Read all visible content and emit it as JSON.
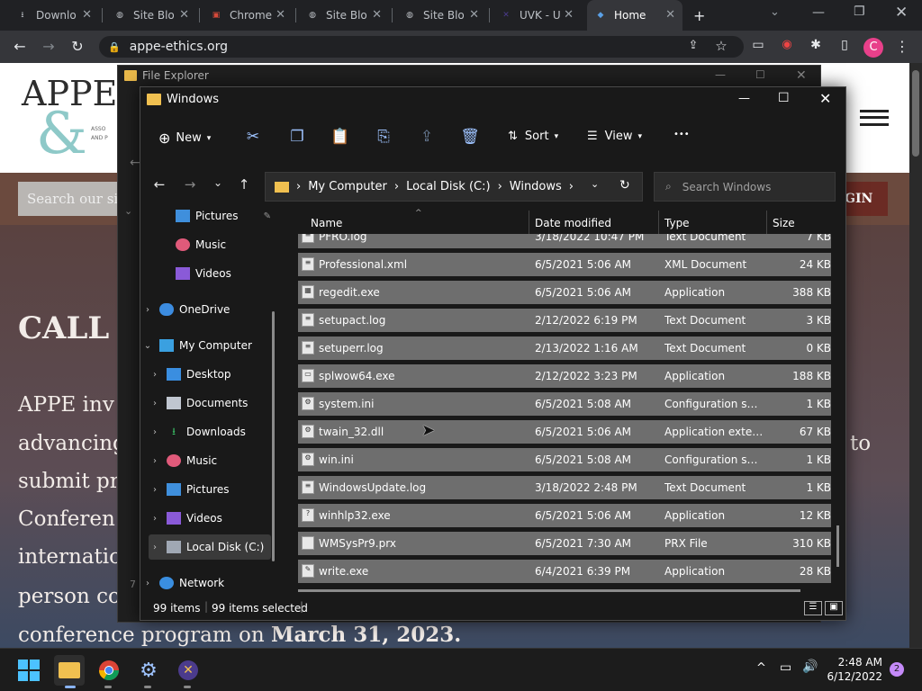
{
  "browser": {
    "tabs": [
      {
        "label": "Downlo",
        "icon": "download-icon"
      },
      {
        "label": "Site Blo",
        "icon": "globe-icon"
      },
      {
        "label": "Chrome",
        "icon": "chrome-icon"
      },
      {
        "label": "Site Blo",
        "icon": "globe-icon"
      },
      {
        "label": "Site Blo",
        "icon": "globe-icon"
      },
      {
        "label": "UVK - U",
        "icon": "uvk-icon"
      },
      {
        "label": "Home",
        "icon": "shield-icon",
        "active": true
      }
    ],
    "url": "appe-ethics.org",
    "profile_initial": "C",
    "new_tab": "+",
    "accent": "#e8408a"
  },
  "website": {
    "logo": "APPE",
    "logo_amp": "&",
    "logo_sub1": "ASSO",
    "logo_sub2": "AND P",
    "search_placeholder": "Search our site...",
    "login_label": "GIN",
    "heading": "CALL",
    "para_lines": [
      "APPE inv",
      "advancing",
      "submit pr",
      "Conferen",
      "internatic",
      "person con"
    ],
    "para_right": "to",
    "last_line_a": "conference program on ",
    "last_line_b": "March 31, 2023."
  },
  "explorer_back": {
    "title": "File Explorer",
    "items_partial": "7 i"
  },
  "explorer": {
    "title": "Windows",
    "commands": {
      "new": "New",
      "sort": "Sort",
      "view": "View",
      "more": "•••"
    },
    "breadcrumb": [
      "My Computer",
      "Local Disk (C:)",
      "Windows"
    ],
    "search_placeholder": "Search Windows",
    "columns": {
      "name": "Name",
      "date": "Date modified",
      "type": "Type",
      "size": "Size"
    },
    "nav": [
      {
        "label": "Pictures",
        "icon": "pictures-icon",
        "pinned": true
      },
      {
        "label": "Music",
        "icon": "music-icon"
      },
      {
        "label": "Videos",
        "icon": "videos-icon"
      },
      {
        "label": "OneDrive",
        "icon": "cloud-icon",
        "chev": ">"
      },
      {
        "label": "My Computer",
        "icon": "computer-icon",
        "chev": "v"
      },
      {
        "label": "Desktop",
        "icon": "desktop-icon",
        "chev": ">"
      },
      {
        "label": "Documents",
        "icon": "documents-icon",
        "chev": ">"
      },
      {
        "label": "Downloads",
        "icon": "downloads-icon",
        "chev": ">"
      },
      {
        "label": "Music",
        "icon": "music-icon",
        "chev": ">"
      },
      {
        "label": "Pictures",
        "icon": "pictures-icon",
        "chev": ">"
      },
      {
        "label": "Videos",
        "icon": "videos-icon",
        "chev": ">"
      },
      {
        "label": "Local Disk (C:)",
        "icon": "drive-icon",
        "chev": ">",
        "selected": true
      },
      {
        "label": "Network",
        "icon": "network-icon",
        "chev": ">"
      }
    ],
    "files": [
      {
        "name": "PFRO.log",
        "date": "3/18/2022 10:47 PM",
        "type": "Text Document",
        "size": "7 KB",
        "icon": "text-file-icon"
      },
      {
        "name": "Professional.xml",
        "date": "6/5/2021 5:06 AM",
        "type": "XML Document",
        "size": "24 KB",
        "icon": "xml-file-icon"
      },
      {
        "name": "regedit.exe",
        "date": "6/5/2021 5:06 AM",
        "type": "Application",
        "size": "388 KB",
        "icon": "regedit-icon"
      },
      {
        "name": "setupact.log",
        "date": "2/12/2022 6:19 PM",
        "type": "Text Document",
        "size": "3 KB",
        "icon": "text-file-icon"
      },
      {
        "name": "setuperr.log",
        "date": "2/13/2022 1:16 AM",
        "type": "Text Document",
        "size": "0 KB",
        "icon": "text-file-icon"
      },
      {
        "name": "splwow64.exe",
        "date": "2/12/2022 3:23 PM",
        "type": "Application",
        "size": "188 KB",
        "icon": "app-icon"
      },
      {
        "name": "system.ini",
        "date": "6/5/2021 5:08 AM",
        "type": "Configuration sett...",
        "size": "1 KB",
        "icon": "config-file-icon"
      },
      {
        "name": "twain_32.dll",
        "date": "6/5/2021 5:06 AM",
        "type": "Application exten...",
        "size": "67 KB",
        "icon": "dll-file-icon"
      },
      {
        "name": "win.ini",
        "date": "6/5/2021 5:08 AM",
        "type": "Configuration sett...",
        "size": "1 KB",
        "icon": "config-file-icon"
      },
      {
        "name": "WindowsUpdate.log",
        "date": "3/18/2022 2:48 PM",
        "type": "Text Document",
        "size": "1 KB",
        "icon": "text-file-icon"
      },
      {
        "name": "winhlp32.exe",
        "date": "6/5/2021 5:06 AM",
        "type": "Application",
        "size": "12 KB",
        "icon": "help-icon"
      },
      {
        "name": "WMSysPr9.prx",
        "date": "6/5/2021 7:30 AM",
        "type": "PRX File",
        "size": "310 KB",
        "icon": "file-icon"
      },
      {
        "name": "write.exe",
        "date": "6/4/2021 6:39 PM",
        "type": "Application",
        "size": "28 KB",
        "icon": "write-icon"
      }
    ],
    "status_items": "99 items",
    "status_selected": "99 items selected"
  },
  "taskbar": {
    "time": "2:48 AM",
    "date": "6/12/2022",
    "notification_count": "2"
  }
}
